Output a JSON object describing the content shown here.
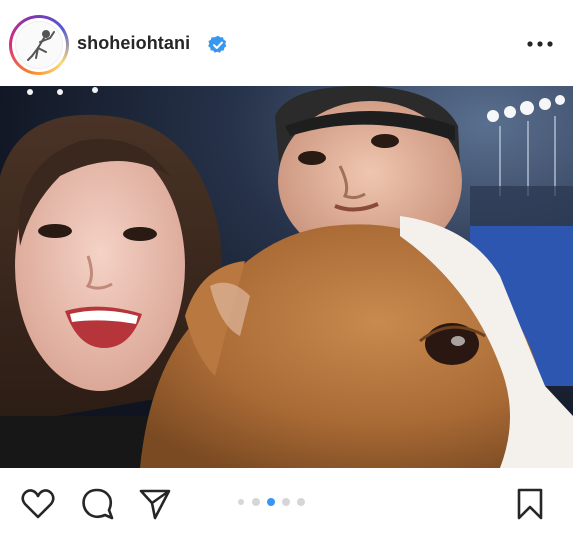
{
  "post": {
    "username": "shoheiohtani",
    "verified": true,
    "carousel": {
      "total": 5,
      "current": 3
    }
  },
  "icons": {
    "avatar": "baseball-player-avatar",
    "verified": "verified-badge-icon",
    "more": "more-options-icon",
    "like": "heart-icon",
    "comment": "comment-icon",
    "share": "send-icon",
    "save": "bookmark-icon"
  },
  "colors": {
    "accent": "#3897f0",
    "text": "#262626",
    "dot_inactive": "#d6d6d6"
  }
}
